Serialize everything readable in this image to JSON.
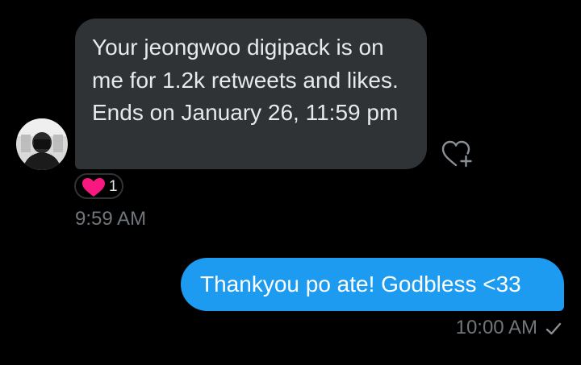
{
  "conversation": {
    "incoming": {
      "message": "Your jeongwoo digipack is on me for 1.2k retweets and likes. Ends on January 26, 11:59 pm",
      "reaction": {
        "icon": "red-heart-icon",
        "count": "1"
      },
      "time": "9:59 AM"
    },
    "outgoing": {
      "message": "Thankyou po ate! Godbless <33",
      "time": "10:00 AM",
      "status_icon": "sent-check-icon"
    }
  },
  "colors": {
    "background": "#000000",
    "incoming_bubble": "#2f3336",
    "outgoing_bubble": "#1d9bf0",
    "timestamp": "#71767b",
    "heart": "#f91880"
  }
}
